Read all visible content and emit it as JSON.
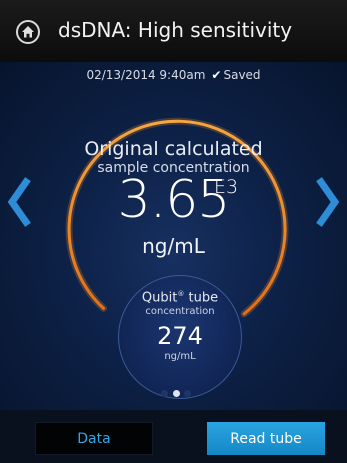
{
  "header": {
    "title": "dsDNA: High sensitivity",
    "home_icon": "home-icon"
  },
  "status": {
    "timestamp": "02/13/2014 9:40am",
    "saved_label": "Saved",
    "saved_icon": "checkmark-icon"
  },
  "main_reading": {
    "label_line1": "Original calculated",
    "label_line2": "sample concentration",
    "value": "3.65",
    "exponent": "E3",
    "unit": "ng/mL"
  },
  "tube_reading": {
    "label_line1": "Qubit",
    "label_mark": "®",
    "label_line1_suffix": " tube",
    "label_line2": "concentration",
    "value": "274",
    "unit": "ng/mL"
  },
  "pager": {
    "count": 3,
    "active_index": 1
  },
  "buttons": {
    "data_label": "Data",
    "read_tube_label": "Read tube"
  },
  "colors": {
    "accent": "#2a9fdb",
    "arc": "#f0932a",
    "background": "#0d2147"
  }
}
